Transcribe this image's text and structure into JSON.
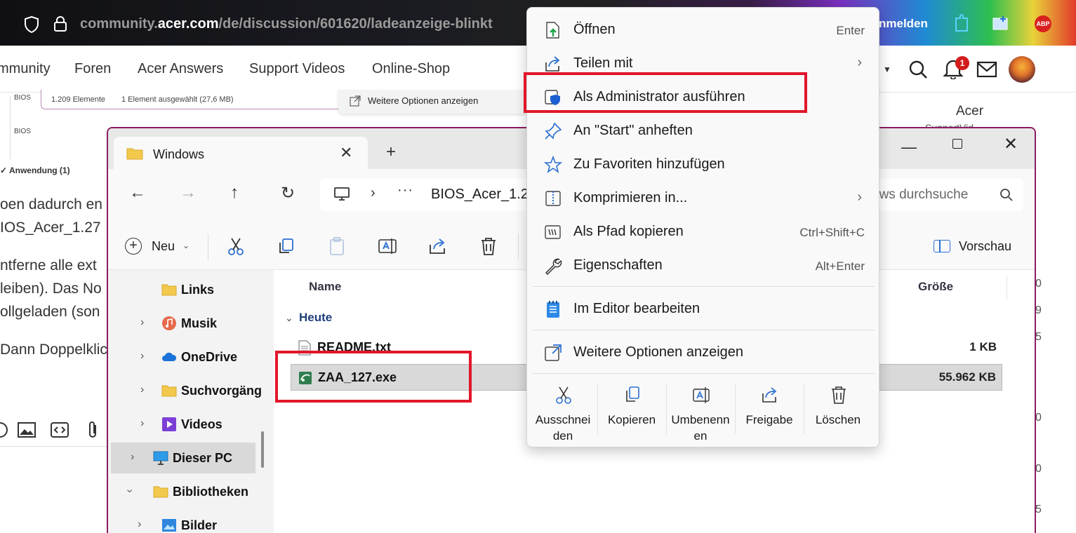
{
  "browser": {
    "url_prefix": "community.",
    "url_host": "acer.com",
    "url_path": "/de/discussion/601620/ladeanzeige-blinkt",
    "login_label": "nmelden",
    "abp_label": "ABP"
  },
  "site_nav": {
    "items": [
      "mmunity",
      "Foren",
      "Acer Answers",
      "Support Videos",
      "Online-Shop"
    ],
    "notification_count": "1",
    "right_label": "Acer",
    "right_label_partial": "SupportVid"
  },
  "background": {
    "snip_count": "1.209 Elemente",
    "snip_selected": "1 Element ausgewählt (27,6 MB)",
    "snip_more_options": "Weitere Optionen anzeigen",
    "bios_label_1": "BIOS",
    "bios_label_2": "BIOS",
    "anwendung": "✓ Anwendung (1)",
    "lines": [
      "oen dadurch en",
      "IOS_Acer_1.27",
      "ntferne alle ext",
      "leiben). Das No",
      "ollgeladen (son",
      "Dann Doppelklic"
    ],
    "right_numbers": [
      "0",
      "9",
      "5",
      "0",
      "0",
      "5"
    ]
  },
  "explorer": {
    "tab_title": "Windows",
    "address_path": "BIOS_Acer_1.27",
    "search_placeholder": "ows durchsuche",
    "new_label": "Neu",
    "preview_label": "Vorschau",
    "nav_items": [
      "Links",
      "Musik",
      "OneDrive",
      "Suchvorgäng",
      "Videos",
      "Dieser PC",
      "Bibliotheken",
      "Bilder"
    ],
    "col_name": "Name",
    "col_size": "Größe",
    "group_label": "Heute",
    "files": [
      {
        "name": "README.txt",
        "size": "1 KB"
      },
      {
        "name": "ZAA_127.exe",
        "size": "55.962 KB"
      }
    ]
  },
  "context_menu": {
    "items": [
      {
        "label": "Öffnen",
        "shortcut": "Enter"
      },
      {
        "label": "Teilen mit",
        "shortcut": ""
      },
      {
        "label": "Als Administrator ausführen",
        "shortcut": ""
      },
      {
        "label": "An \"Start\" anheften",
        "shortcut": ""
      },
      {
        "label": "Zu Favoriten hinzufügen",
        "shortcut": ""
      },
      {
        "label": "Komprimieren in...",
        "shortcut": ""
      },
      {
        "label": "Als Pfad kopieren",
        "shortcut": "Ctrl+Shift+C"
      },
      {
        "label": "Eigenschaften",
        "shortcut": "Alt+Enter"
      },
      {
        "label": "Im Editor bearbeiten",
        "shortcut": ""
      },
      {
        "label": "Weitere Optionen anzeigen",
        "shortcut": ""
      }
    ],
    "quick_actions": [
      "Ausschnei den",
      "Kopieren",
      "Umbenenn en",
      "Freigabe",
      "Löschen"
    ]
  },
  "colors": {
    "highlight": "#e2162a",
    "window_border": "#8b1c62",
    "accent": "#2b6fd1"
  }
}
